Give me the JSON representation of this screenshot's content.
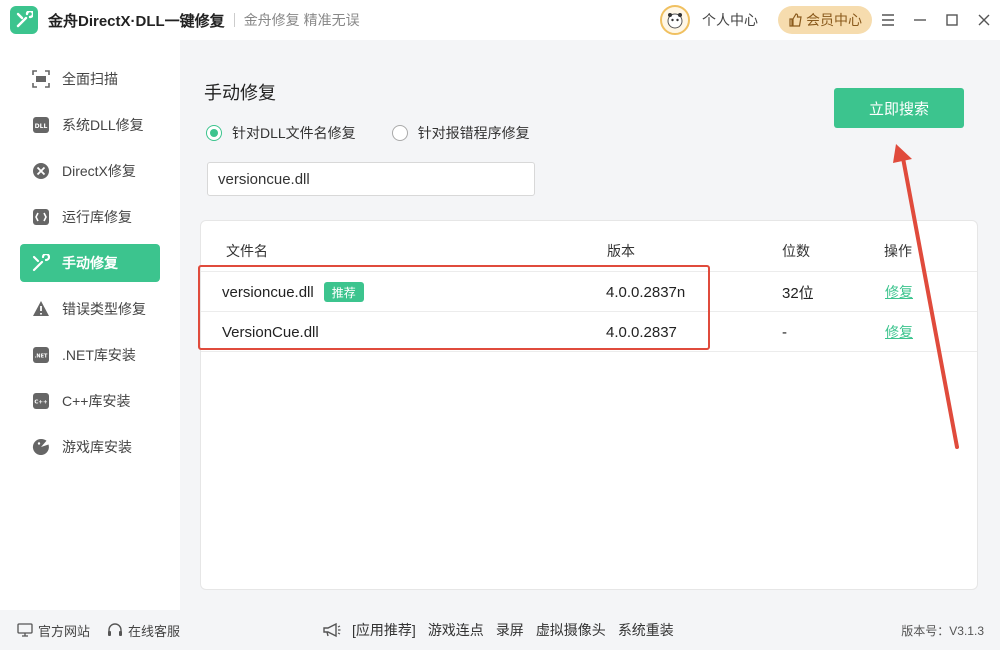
{
  "titlebar": {
    "app_name": "金舟DirectX·DLL一键修复",
    "subtitle": "金舟修复 精准无误",
    "user_center": "个人中心",
    "vip_center": "会员中心"
  },
  "sidebar": {
    "items": [
      {
        "label": "全面扫描",
        "icon": "scan-icon"
      },
      {
        "label": "系统DLL修复",
        "icon": "dll-icon"
      },
      {
        "label": "DirectX修复",
        "icon": "directx-icon"
      },
      {
        "label": "运行库修复",
        "icon": "runtime-icon"
      },
      {
        "label": "手动修复",
        "icon": "wrench-icon",
        "active": true
      },
      {
        "label": "错误类型修复",
        "icon": "warning-icon"
      },
      {
        "label": ".NET库安装",
        "icon": "dotnet-icon"
      },
      {
        "label": "C++库安装",
        "icon": "cpp-icon"
      },
      {
        "label": "游戏库安装",
        "icon": "game-icon"
      }
    ]
  },
  "main": {
    "title": "手动修复",
    "radio_options": [
      {
        "label": "针对DLL文件名修复",
        "checked": true
      },
      {
        "label": "针对报错程序修复",
        "checked": false
      }
    ],
    "search_value": "versioncue.dll",
    "search_button": "立即搜索",
    "table": {
      "headers": [
        "文件名",
        "版本",
        "位数",
        "操作"
      ],
      "rows": [
        {
          "name": "versioncue.dll",
          "badge": "推荐",
          "version": "4.0.0.2837n",
          "bits": "32位",
          "action": "修复"
        },
        {
          "name": "VersionCue.dll",
          "badge": "",
          "version": "4.0.0.2837",
          "bits": "-",
          "action": "修复"
        }
      ]
    }
  },
  "footer": {
    "official_site": "官方网站",
    "online_service": "在线客服",
    "links": [
      "[应用推荐]",
      "游戏连点",
      "录屏",
      "虚拟摄像头",
      "系统重装"
    ],
    "version": "版本号：V3.1.3"
  },
  "colors": {
    "accent": "#3cc48e",
    "annotation_red": "#e04b3c",
    "vip_bg": "#f6dcae"
  }
}
